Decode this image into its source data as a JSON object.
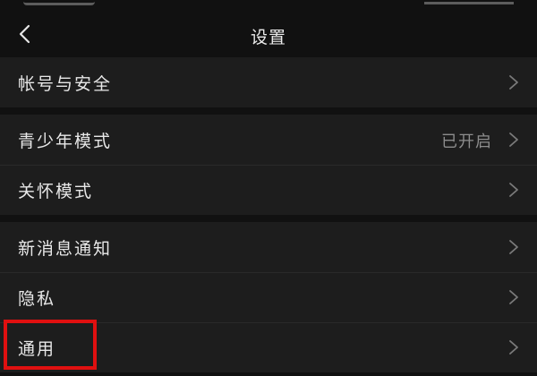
{
  "header": {
    "title": "设置",
    "back_icon": "chevron-left-icon"
  },
  "groups": [
    {
      "items": [
        {
          "label": "帐号与安全",
          "value": ""
        }
      ]
    },
    {
      "items": [
        {
          "label": "青少年模式",
          "value": "已开启"
        },
        {
          "label": "关怀模式",
          "value": ""
        }
      ]
    },
    {
      "items": [
        {
          "label": "新消息通知",
          "value": ""
        },
        {
          "label": "隐私",
          "value": ""
        },
        {
          "label": "通用",
          "value": ""
        }
      ]
    }
  ],
  "colors": {
    "background": "#111111",
    "row_background": "#1d1d1d",
    "highlight": "#e01010",
    "secondary_text": "#8d8d8d"
  }
}
